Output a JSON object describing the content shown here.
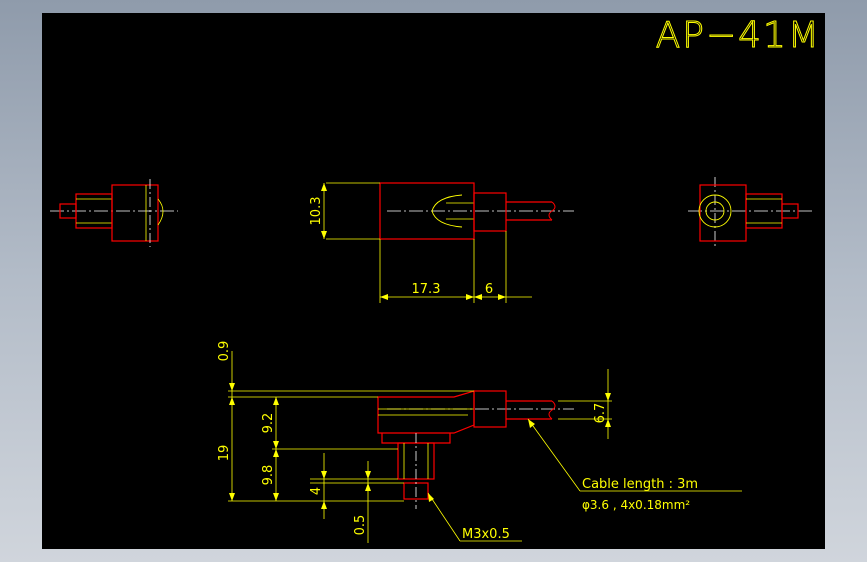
{
  "title": "AP−41M",
  "dimensions": {
    "front_height": "10.3",
    "front_length": "17.3",
    "front_tip": "6",
    "side_gap_top": "0.9",
    "side_total": "19",
    "side_upper": "9.2",
    "side_lower": "9.8",
    "side_thread": "4",
    "side_tip": "0.5",
    "cable_dia": "6.7"
  },
  "notes": {
    "cable_length": "Cable length : 3m",
    "cable_spec": "φ3.6 , 4x0.18mm²",
    "thread": "M3x0.5"
  },
  "colors": {
    "background": "#000000",
    "outline": "#ff0000",
    "dimension": "#ffff00",
    "center_line": "#ffffff"
  }
}
